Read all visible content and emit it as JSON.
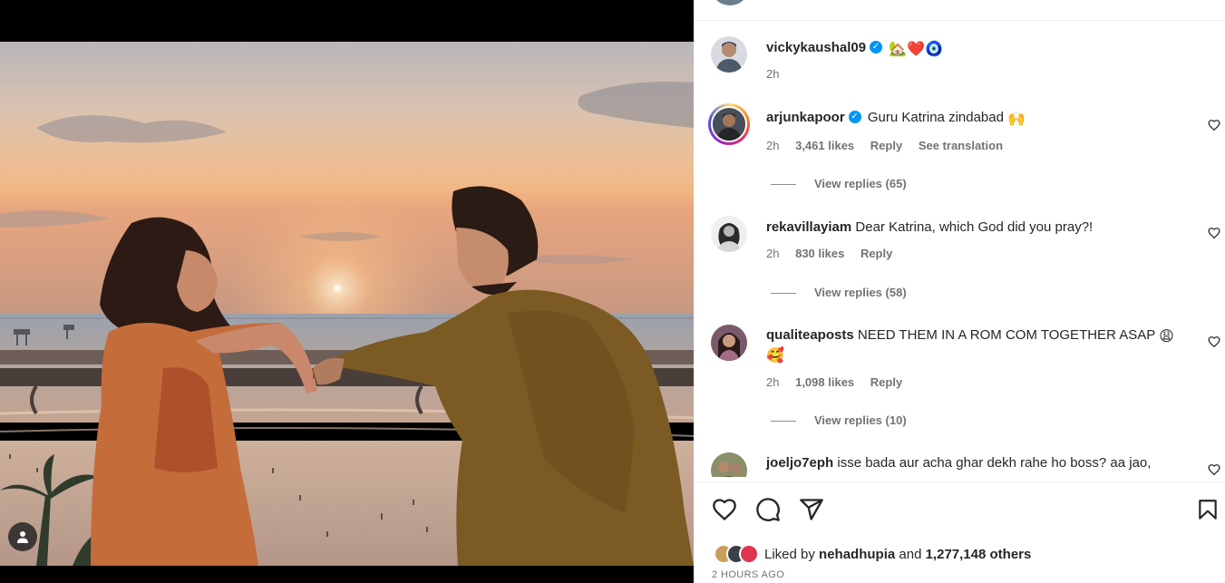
{
  "post": {
    "author": "vickykaushal09",
    "caption": "🏡❤️🧿",
    "time": "2h",
    "verified_mark": "✓"
  },
  "comments": [
    {
      "user": "arjunkapoor",
      "verified": true,
      "text": "Guru Katrina zindabad",
      "emoji": "🙌",
      "time": "2h",
      "likes": "3,461 likes",
      "reply": "Reply",
      "translate": "See translation",
      "view_replies": "View replies (65)"
    },
    {
      "user": "rekavillayiam",
      "verified": false,
      "text": "Dear Katrina, which God did you pray?!",
      "time": "2h",
      "likes": "830 likes",
      "reply": "Reply",
      "view_replies": "View replies (58)"
    },
    {
      "user": "qualiteaposts",
      "verified": false,
      "text": "NEED THEM IN A ROM COM TOGETHER ASAP",
      "emoji": "😩🥰",
      "time": "2h",
      "likes": "1,098 likes",
      "reply": "Reply",
      "view_replies": "View replies (10)"
    },
    {
      "user": "joeljo7eph",
      "verified": false,
      "text": "isse bada aur acha ghar dekh rahe ho boss? aa jao,"
    }
  ],
  "likes": {
    "prefix": "Liked by",
    "user": "nehadhupia",
    "connector": "and",
    "others": "1,277,148 others"
  },
  "posted_ago": "2 HOURS AGO",
  "icons": [
    "like-icon",
    "comment-icon",
    "share-icon",
    "save-icon",
    "comment-like-icon",
    "tag-user-icon",
    "verified-icon"
  ]
}
